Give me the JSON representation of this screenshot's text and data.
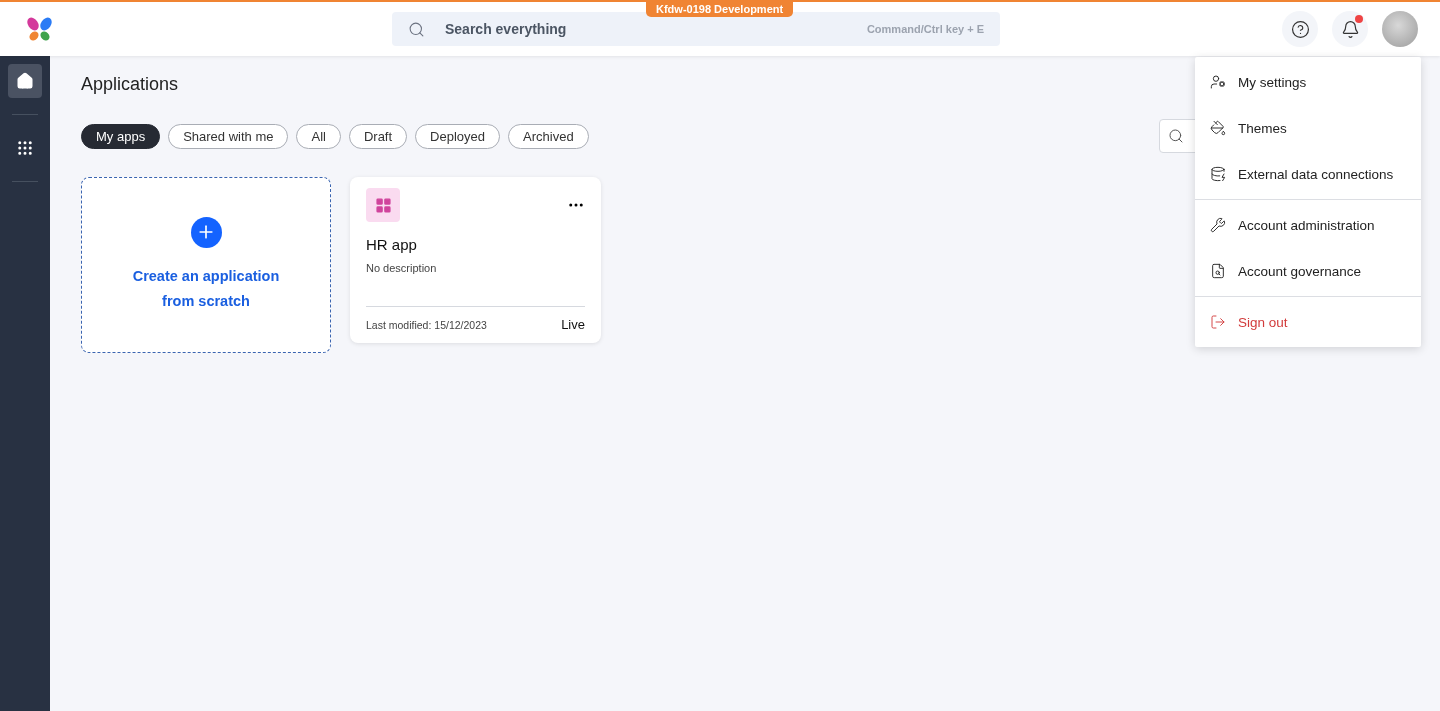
{
  "env_badge": "Kfdw-0198 Development",
  "search": {
    "placeholder": "Search everything",
    "shortcut": "Command/Ctrl key + E"
  },
  "notifications": {
    "unread": true
  },
  "sidebar": {
    "items": [
      {
        "selected": true
      },
      {
        "selected": false
      }
    ]
  },
  "page_title": "Applications",
  "filters": [
    {
      "label": "My apps",
      "selected": true
    },
    {
      "label": "Shared with me",
      "selected": false
    },
    {
      "label": "All",
      "selected": false
    },
    {
      "label": "Draft",
      "selected": false
    },
    {
      "label": "Deployed",
      "selected": false
    },
    {
      "label": "Archived",
      "selected": false
    }
  ],
  "create_card": {
    "label": "Create an application from scratch"
  },
  "apps": [
    {
      "name": "HR app",
      "description": "No description",
      "modified": "Last modified: 15/12/2023",
      "status": "Live"
    }
  ],
  "menu": {
    "groups": [
      [
        {
          "label": "My settings",
          "kind": "normal"
        },
        {
          "label": "Themes",
          "kind": "normal"
        },
        {
          "label": "External data connections",
          "kind": "normal"
        }
      ],
      [
        {
          "label": "Account administration",
          "kind": "normal"
        },
        {
          "label": "Account governance",
          "kind": "normal"
        }
      ],
      [
        {
          "label": "Sign out",
          "kind": "danger"
        }
      ]
    ]
  }
}
